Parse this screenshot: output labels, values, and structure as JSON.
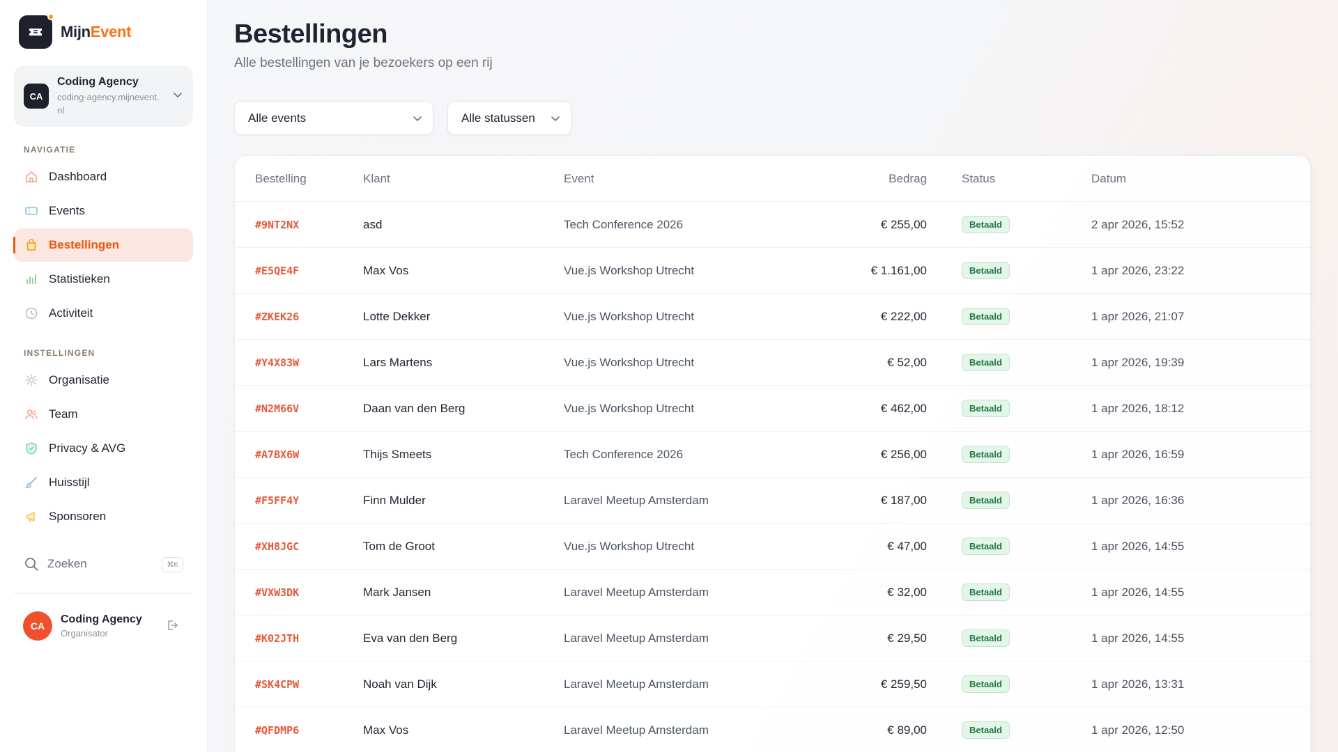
{
  "brand": {
    "name_main": "Mijn",
    "name_accent": "Event"
  },
  "org": {
    "initials": "CA",
    "name": "Coding Agency",
    "domain": "coding-agency.mijnevent.nl"
  },
  "nav": {
    "section_label": "NAVIGATIE",
    "items": [
      {
        "label": "Dashboard",
        "icon": "home-icon"
      },
      {
        "label": "Events",
        "icon": "ticket-icon"
      },
      {
        "label": "Bestellingen",
        "icon": "shopping-bag-icon",
        "active": true
      },
      {
        "label": "Statistieken",
        "icon": "bar-chart-icon"
      },
      {
        "label": "Activiteit",
        "icon": "clock-icon"
      }
    ]
  },
  "settings": {
    "section_label": "INSTELLINGEN",
    "items": [
      {
        "label": "Organisatie",
        "icon": "gear-icon"
      },
      {
        "label": "Team",
        "icon": "users-icon"
      },
      {
        "label": "Privacy & AVG",
        "icon": "shield-icon"
      },
      {
        "label": "Huisstijl",
        "icon": "brush-icon"
      },
      {
        "label": "Sponsoren",
        "icon": "megaphone-icon"
      }
    ]
  },
  "search": {
    "label": "Zoeken",
    "shortcut": "⌘K"
  },
  "user": {
    "initials": "CA",
    "name": "Coding Agency",
    "role": "Organisator"
  },
  "page": {
    "title": "Bestellingen",
    "subtitle": "Alle bestellingen van je bezoekers op een rij"
  },
  "filters": {
    "events": "Alle events",
    "status": "Alle statussen"
  },
  "table": {
    "headers": [
      "Bestelling",
      "Klant",
      "Event",
      "Bedrag",
      "Status",
      "Datum"
    ],
    "rows": [
      {
        "id": "#9NT2NX",
        "customer": "asd",
        "event": "Tech Conference 2026",
        "amount": "€ 255,00",
        "status": "Betaald",
        "date": "2 apr 2026, 15:52"
      },
      {
        "id": "#E5QE4F",
        "customer": "Max Vos",
        "event": "Vue.js Workshop Utrecht",
        "amount": "€ 1.161,00",
        "status": "Betaald",
        "date": "1 apr 2026, 23:22"
      },
      {
        "id": "#ZKEK26",
        "customer": "Lotte Dekker",
        "event": "Vue.js Workshop Utrecht",
        "amount": "€ 222,00",
        "status": "Betaald",
        "date": "1 apr 2026, 21:07"
      },
      {
        "id": "#Y4X83W",
        "customer": "Lars Martens",
        "event": "Vue.js Workshop Utrecht",
        "amount": "€ 52,00",
        "status": "Betaald",
        "date": "1 apr 2026, 19:39"
      },
      {
        "id": "#N2M66V",
        "customer": "Daan van den Berg",
        "event": "Vue.js Workshop Utrecht",
        "amount": "€ 462,00",
        "status": "Betaald",
        "date": "1 apr 2026, 18:12"
      },
      {
        "id": "#A7BX6W",
        "customer": "Thijs Smeets",
        "event": "Tech Conference 2026",
        "amount": "€ 256,00",
        "status": "Betaald",
        "date": "1 apr 2026, 16:59"
      },
      {
        "id": "#F5FF4Y",
        "customer": "Finn Mulder",
        "event": "Laravel Meetup Amsterdam",
        "amount": "€ 187,00",
        "status": "Betaald",
        "date": "1 apr 2026, 16:36"
      },
      {
        "id": "#XH8JGC",
        "customer": "Tom de Groot",
        "event": "Vue.js Workshop Utrecht",
        "amount": "€ 47,00",
        "status": "Betaald",
        "date": "1 apr 2026, 14:55"
      },
      {
        "id": "#VXW3DK",
        "customer": "Mark Jansen",
        "event": "Laravel Meetup Amsterdam",
        "amount": "€ 32,00",
        "status": "Betaald",
        "date": "1 apr 2026, 14:55"
      },
      {
        "id": "#K02JTH",
        "customer": "Eva van den Berg",
        "event": "Laravel Meetup Amsterdam",
        "amount": "€ 29,50",
        "status": "Betaald",
        "date": "1 apr 2026, 14:55"
      },
      {
        "id": "#SK4CPW",
        "customer": "Noah van Dijk",
        "event": "Laravel Meetup Amsterdam",
        "amount": "€ 259,50",
        "status": "Betaald",
        "date": "1 apr 2026, 13:31"
      },
      {
        "id": "#QFDMP6",
        "customer": "Max Vos",
        "event": "Laravel Meetup Amsterdam",
        "amount": "€ 89,00",
        "status": "Betaald",
        "date": "1 apr 2026, 12:50"
      }
    ]
  },
  "colors": {
    "accent": "#ea580c",
    "order_id": "#e8593a",
    "paid_badge_bg": "#e4f5e9",
    "paid_badge_text": "#1f7a45"
  }
}
